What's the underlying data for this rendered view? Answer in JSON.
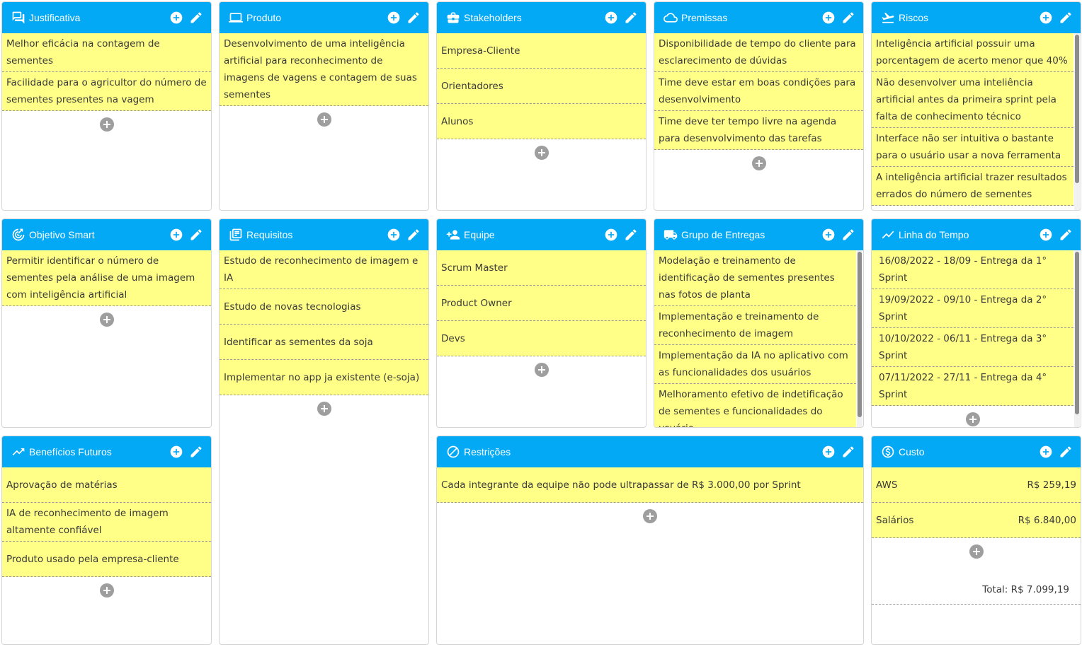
{
  "panels": {
    "justificativa": {
      "title": "Justificativa",
      "items": [
        "Melhor eficácia na contagem de sementes",
        "Facilidade para o agricultor do número de sementes presentes na vagem"
      ]
    },
    "produto": {
      "title": "Produto",
      "items": [
        "Desenvolvimento de uma inteligência artificial para reconhecimento de imagens de vagens e contagem de suas sementes"
      ]
    },
    "stakeholders": {
      "title": "Stakeholders",
      "items": [
        "Empresa-Cliente",
        "Orientadores",
        "Alunos"
      ]
    },
    "premissas": {
      "title": "Premissas",
      "items": [
        "Disponibilidade de tempo do cliente para esclarecimento de dúvidas",
        "Time deve estar em boas condições para desenvolvimento",
        "Time deve ter tempo livre na agenda para desenvolvimento das tarefas"
      ]
    },
    "riscos": {
      "title": "Riscos",
      "items": [
        "Inteligência artificial possuir uma porcentagem de acerto menor que 40%",
        "Não desenvolver uma inteliência artificial antes da primeira sprint pela falta de conhecimento técnico",
        "Interface não ser intuitiva o bastante para o usuário usar a nova ferramenta",
        "A inteligência artificial trazer resultados errados do número de sementes"
      ]
    },
    "objetivo": {
      "title": "Objetivo Smart",
      "items": [
        "Permitir identificar o número de sementes pela análise de uma imagem com inteligência artificial"
      ]
    },
    "requisitos": {
      "title": "Requisitos",
      "items": [
        "Estudo de reconhecimento de imagem e IA",
        "Estudo de novas tecnologias",
        "Identificar as sementes da soja",
        "Implementar no app ja existente (e-soja)"
      ]
    },
    "equipe": {
      "title": "Equipe",
      "items": [
        "Scrum Master",
        "Product Owner",
        "Devs"
      ]
    },
    "entregas": {
      "title": "Grupo de Entregas",
      "items": [
        "Modelação e treinamento de identificação de sementes presentes nas fotos de planta",
        "Implementação e treinamento de reconhecimento de imagem",
        "Implementação da IA no aplicativo com as funcionalidades dos usuários",
        "Melhoramento efetivo de indetificação de sementes e funcionalidades do usuário"
      ]
    },
    "linha": {
      "title": "Linha do Tempo",
      "items": [
        "16/08/2022 - 18/09 - Entrega da 1° Sprint",
        "19/09/2022 - 09/10 - Entrega da 2° Sprint",
        "10/10/2022 - 06/11 - Entrega da 3° Sprint",
        "07/11/2022 - 27/11 - Entrega da 4° Sprint"
      ]
    },
    "beneficios": {
      "title": "Benefícios Futuros",
      "items": [
        "Aprovação de matérias",
        "IA de reconhecimento de imagem altamente confiável",
        "Produto usado pela empresa-cliente"
      ]
    },
    "restricoes": {
      "title": "Restrições",
      "items": [
        "Cada integrante da equipe não pode ultrapassar de R$ 3.000,00 por Sprint"
      ]
    },
    "custo": {
      "title": "Custo",
      "items": [
        {
          "label": "AWS",
          "amount": "R$ 259,19"
        },
        {
          "label": "Salários",
          "amount": "R$ 6.840,00"
        }
      ],
      "total": "Total: R$ 7.099,19"
    }
  },
  "icons": {
    "header_add": "plus-circle-icon",
    "header_edit": "pencil-icon"
  },
  "colors": {
    "header": "#03a9f4",
    "note": "#ffff88"
  }
}
